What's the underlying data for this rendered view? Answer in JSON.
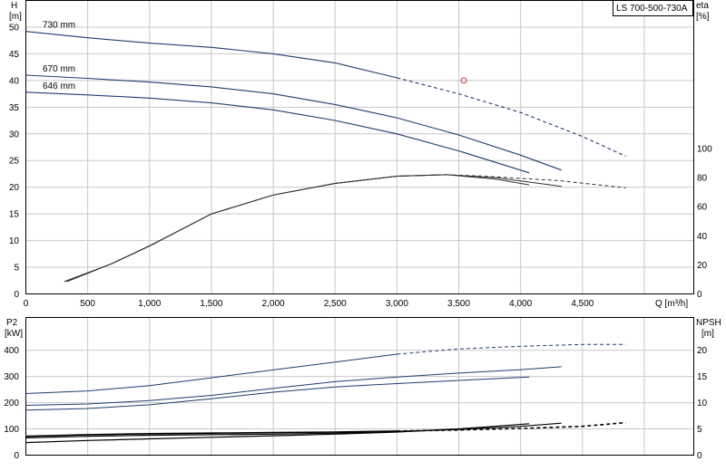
{
  "chart_data": [
    {
      "type": "line",
      "title": "LS 700-500-730A",
      "xlabel": "Q [m³/h]",
      "ylabel_line1": "H",
      "ylabel_line2": "[m]",
      "y2label_line1": "eta",
      "y2label_line2": "[%]",
      "xlim": [
        0,
        5400
      ],
      "ylim": [
        0,
        55
      ],
      "y2lim": [
        0,
        100
      ],
      "x_ticks": [
        0,
        500,
        1000,
        1500,
        2000,
        2500,
        3000,
        3500,
        4000,
        4500
      ],
      "x_tick_labels": [
        "0",
        "500",
        "1,000",
        "1,500",
        "2,000",
        "2,500",
        "3,000",
        "3,500",
        "4,000",
        "4,500"
      ],
      "y_ticks": [
        0,
        5,
        10,
        15,
        20,
        25,
        30,
        35,
        40,
        45,
        50
      ],
      "y_tick_labels": [
        "0",
        "5",
        "10",
        "15",
        "20",
        "25",
        "30",
        "35",
        "40",
        "45",
        "50"
      ],
      "y2_ticks": [
        0,
        20,
        40,
        60,
        80,
        100
      ],
      "y2_tick_labels": [
        "0",
        "20",
        "40",
        "60",
        "80",
        "100"
      ],
      "grid": true,
      "head_series": [
        {
          "name": "730 mm",
          "color": "#1f3d6e",
          "x": [
            0,
            500,
            1000,
            1500,
            2000,
            2500,
            3000,
            3500,
            4000,
            4500,
            4850
          ],
          "y": [
            49.2,
            48,
            47,
            46.2,
            45,
            43.3,
            40.5,
            37.5,
            34,
            29.5,
            25.8
          ],
          "dashed_from_x": 3000
        },
        {
          "name": "670 mm",
          "color": "#1f3d6e",
          "x": [
            0,
            500,
            1000,
            1500,
            2000,
            2500,
            3000,
            3500,
            4000,
            4330
          ],
          "y": [
            41,
            40.4,
            39.7,
            38.8,
            37.5,
            35.5,
            33,
            29.8,
            26,
            23.2
          ]
        },
        {
          "name": "646 mm",
          "color": "#1f3d6e",
          "x": [
            0,
            500,
            1000,
            1500,
            2000,
            2500,
            3000,
            3500,
            4070
          ],
          "y": [
            37.8,
            37.3,
            36.7,
            35.8,
            34.5,
            32.5,
            30,
            26.8,
            22.7
          ]
        }
      ],
      "efficiency_series": [
        {
          "name": "",
          "color": "#333333",
          "line_width": 1,
          "x": [
            330,
            700,
            1000,
            1500,
            2000,
            2500,
            3000,
            3400,
            3700,
            4300,
            4850
          ],
          "y": [
            8.5,
            21,
            33,
            55,
            68,
            76,
            81,
            82,
            81,
            78,
            73
          ],
          "dashed_from_x": 3400
        },
        {
          "name": "",
          "color": "#333333",
          "line_width": 1,
          "x": [
            310,
            700,
            1000,
            1500,
            2000,
            2500,
            3000,
            3400,
            3800,
            4330
          ],
          "y": [
            8.5,
            21,
            33,
            55,
            68,
            76,
            81,
            82,
            80,
            74
          ]
        },
        {
          "name": "",
          "color": "#333333",
          "line_width": 1,
          "x": [
            330,
            700,
            1000,
            1500,
            2000,
            2500,
            3000,
            3400,
            3800,
            4070
          ],
          "y": [
            8.5,
            21,
            33,
            55,
            68,
            76,
            81,
            82,
            79,
            75
          ]
        }
      ],
      "annotations": [
        {
          "type": "duty-point-marker",
          "x": 3540,
          "y": 40,
          "color": "#e03030"
        }
      ]
    },
    {
      "type": "line",
      "xlabel": "",
      "ylabel_line1": "P2",
      "ylabel_line2": "[kW]",
      "y2label_line1": "NPSH",
      "y2label_line2": "[m]",
      "xlim": [
        0,
        5400
      ],
      "ylim": [
        0,
        525
      ],
      "y2lim": [
        0,
        26.25
      ],
      "y_ticks": [
        0,
        100,
        200,
        300,
        400
      ],
      "y_tick_labels": [
        "0",
        "100",
        "200",
        "300",
        "400"
      ],
      "y2_ticks": [
        0,
        5,
        10,
        15,
        20
      ],
      "y2_tick_labels": [
        "0",
        "5",
        "10",
        "15",
        "20"
      ],
      "grid": true,
      "power_series": [
        {
          "name": "",
          "color": "#1f3d6e",
          "line_width": 1,
          "x": [
            0,
            500,
            1000,
            1500,
            2000,
            2500,
            3000,
            3500,
            4000,
            4500,
            4850
          ],
          "y": [
            235,
            245,
            265,
            295,
            325,
            355,
            385,
            405,
            415,
            422,
            422
          ],
          "dashed_from_x": 3000
        },
        {
          "name": "",
          "color": "#1f3d6e",
          "line_width": 1,
          "x": [
            0,
            500,
            1000,
            1500,
            2000,
            2500,
            3000,
            3500,
            4000,
            4330
          ],
          "y": [
            190,
            195,
            208,
            228,
            255,
            280,
            298,
            313,
            326,
            337
          ]
        },
        {
          "name": "",
          "color": "#1f3d6e",
          "line_width": 1,
          "x": [
            0,
            500,
            1000,
            1500,
            2000,
            2500,
            3000,
            3500,
            4070
          ],
          "y": [
            172,
            178,
            192,
            215,
            240,
            260,
            273,
            285,
            298
          ]
        }
      ],
      "npsh_series": [
        {
          "name": "",
          "color": "#000000",
          "line_width": 1.6,
          "x": [
            0,
            500,
            1000,
            1500,
            2000,
            2500,
            3000,
            3500,
            4000,
            4500,
            4850
          ],
          "y": [
            3.6,
            3.9,
            4.1,
            4.2,
            4.3,
            4.4,
            4.6,
            4.8,
            5.1,
            5.5,
            6.2
          ],
          "dashed_from_x": 3000
        },
        {
          "name": "",
          "color": "#000000",
          "line_width": 1.2,
          "x": [
            0,
            500,
            1000,
            1500,
            2000,
            2500,
            3000,
            3500,
            4000,
            4330
          ],
          "y": [
            3.3,
            3.6,
            3.8,
            3.9,
            4.0,
            4.2,
            4.5,
            4.9,
            5.5,
            6.1
          ]
        },
        {
          "name": "",
          "color": "#000000",
          "line_width": 1.2,
          "x": [
            0,
            500,
            1000,
            1500,
            2000,
            2500,
            3000,
            3500,
            4070
          ],
          "y": [
            2.4,
            2.8,
            3.1,
            3.4,
            3.7,
            4.0,
            4.4,
            5.0,
            6.0
          ]
        }
      ]
    }
  ]
}
